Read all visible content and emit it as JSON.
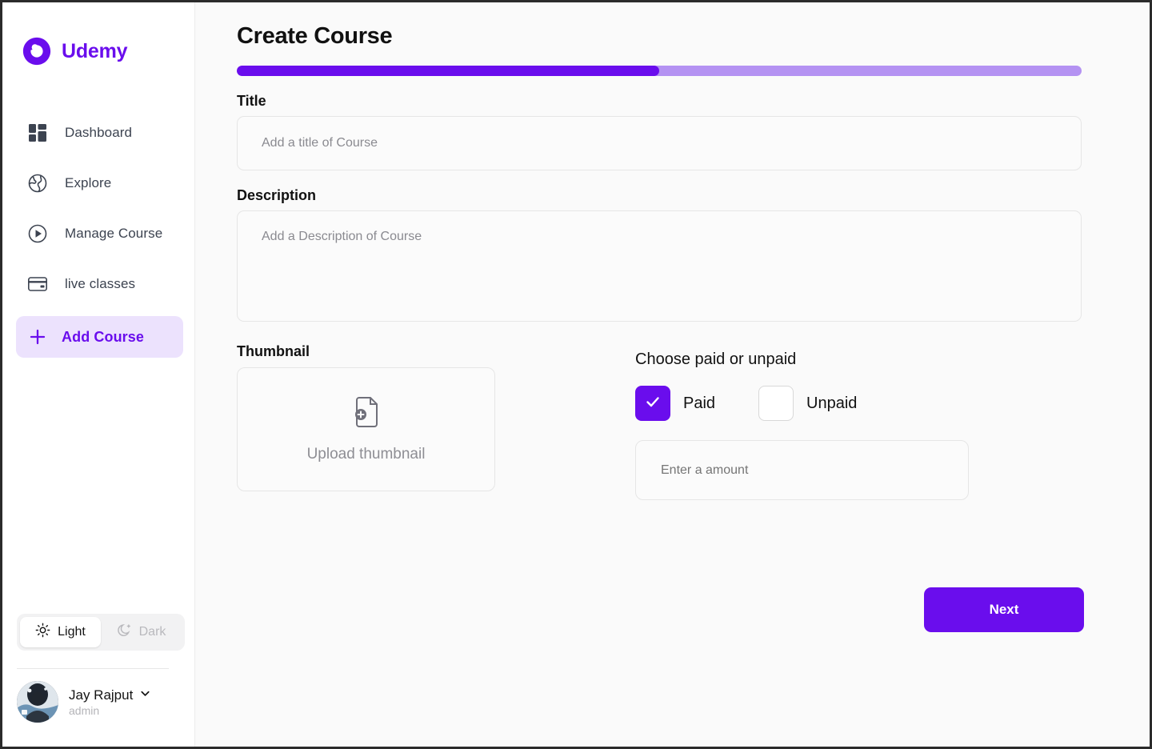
{
  "brand": {
    "name": "Udemy",
    "logo_icon": "udemy-logo-icon",
    "color": "#6a0ded"
  },
  "sidebar": {
    "items": [
      {
        "label": "Dashboard",
        "icon": "dashboard-grid-icon"
      },
      {
        "label": "Explore",
        "icon": "globe-icon"
      },
      {
        "label": "Manage Course",
        "icon": "play-circle-icon"
      },
      {
        "label": "live classes",
        "icon": "credit-card-icon"
      }
    ],
    "add_course": {
      "label": "Add Course",
      "icon": "plus-icon",
      "active": true
    },
    "theme": {
      "light_label": "Light",
      "light_icon": "sun-icon",
      "dark_label": "Dark",
      "dark_icon": "moon-icon",
      "selected": "Light"
    },
    "profile": {
      "name": "Jay Rajput",
      "role": "admin",
      "chevron_icon": "chevron-down-icon",
      "avatar_icon": "avatar"
    }
  },
  "main": {
    "title": "Create Course",
    "progress": {
      "percent": 50
    },
    "title_field": {
      "label": "Title",
      "value": "",
      "placeholder": "Add a title of Course"
    },
    "description_field": {
      "label": "Description",
      "value": "",
      "placeholder": "Add a Description of Course"
    },
    "thumbnail": {
      "label": "Thumbnail",
      "upload_text": "Upload thumbnail",
      "icon": "file-plus-icon"
    },
    "pricing": {
      "label": "Choose paid or unpaid",
      "paid_label": "Paid",
      "paid_checked": true,
      "unpaid_label": "Unpaid",
      "unpaid_checked": false,
      "amount_value": "",
      "amount_placeholder": "Enter a amount"
    },
    "next_button": "Next"
  }
}
